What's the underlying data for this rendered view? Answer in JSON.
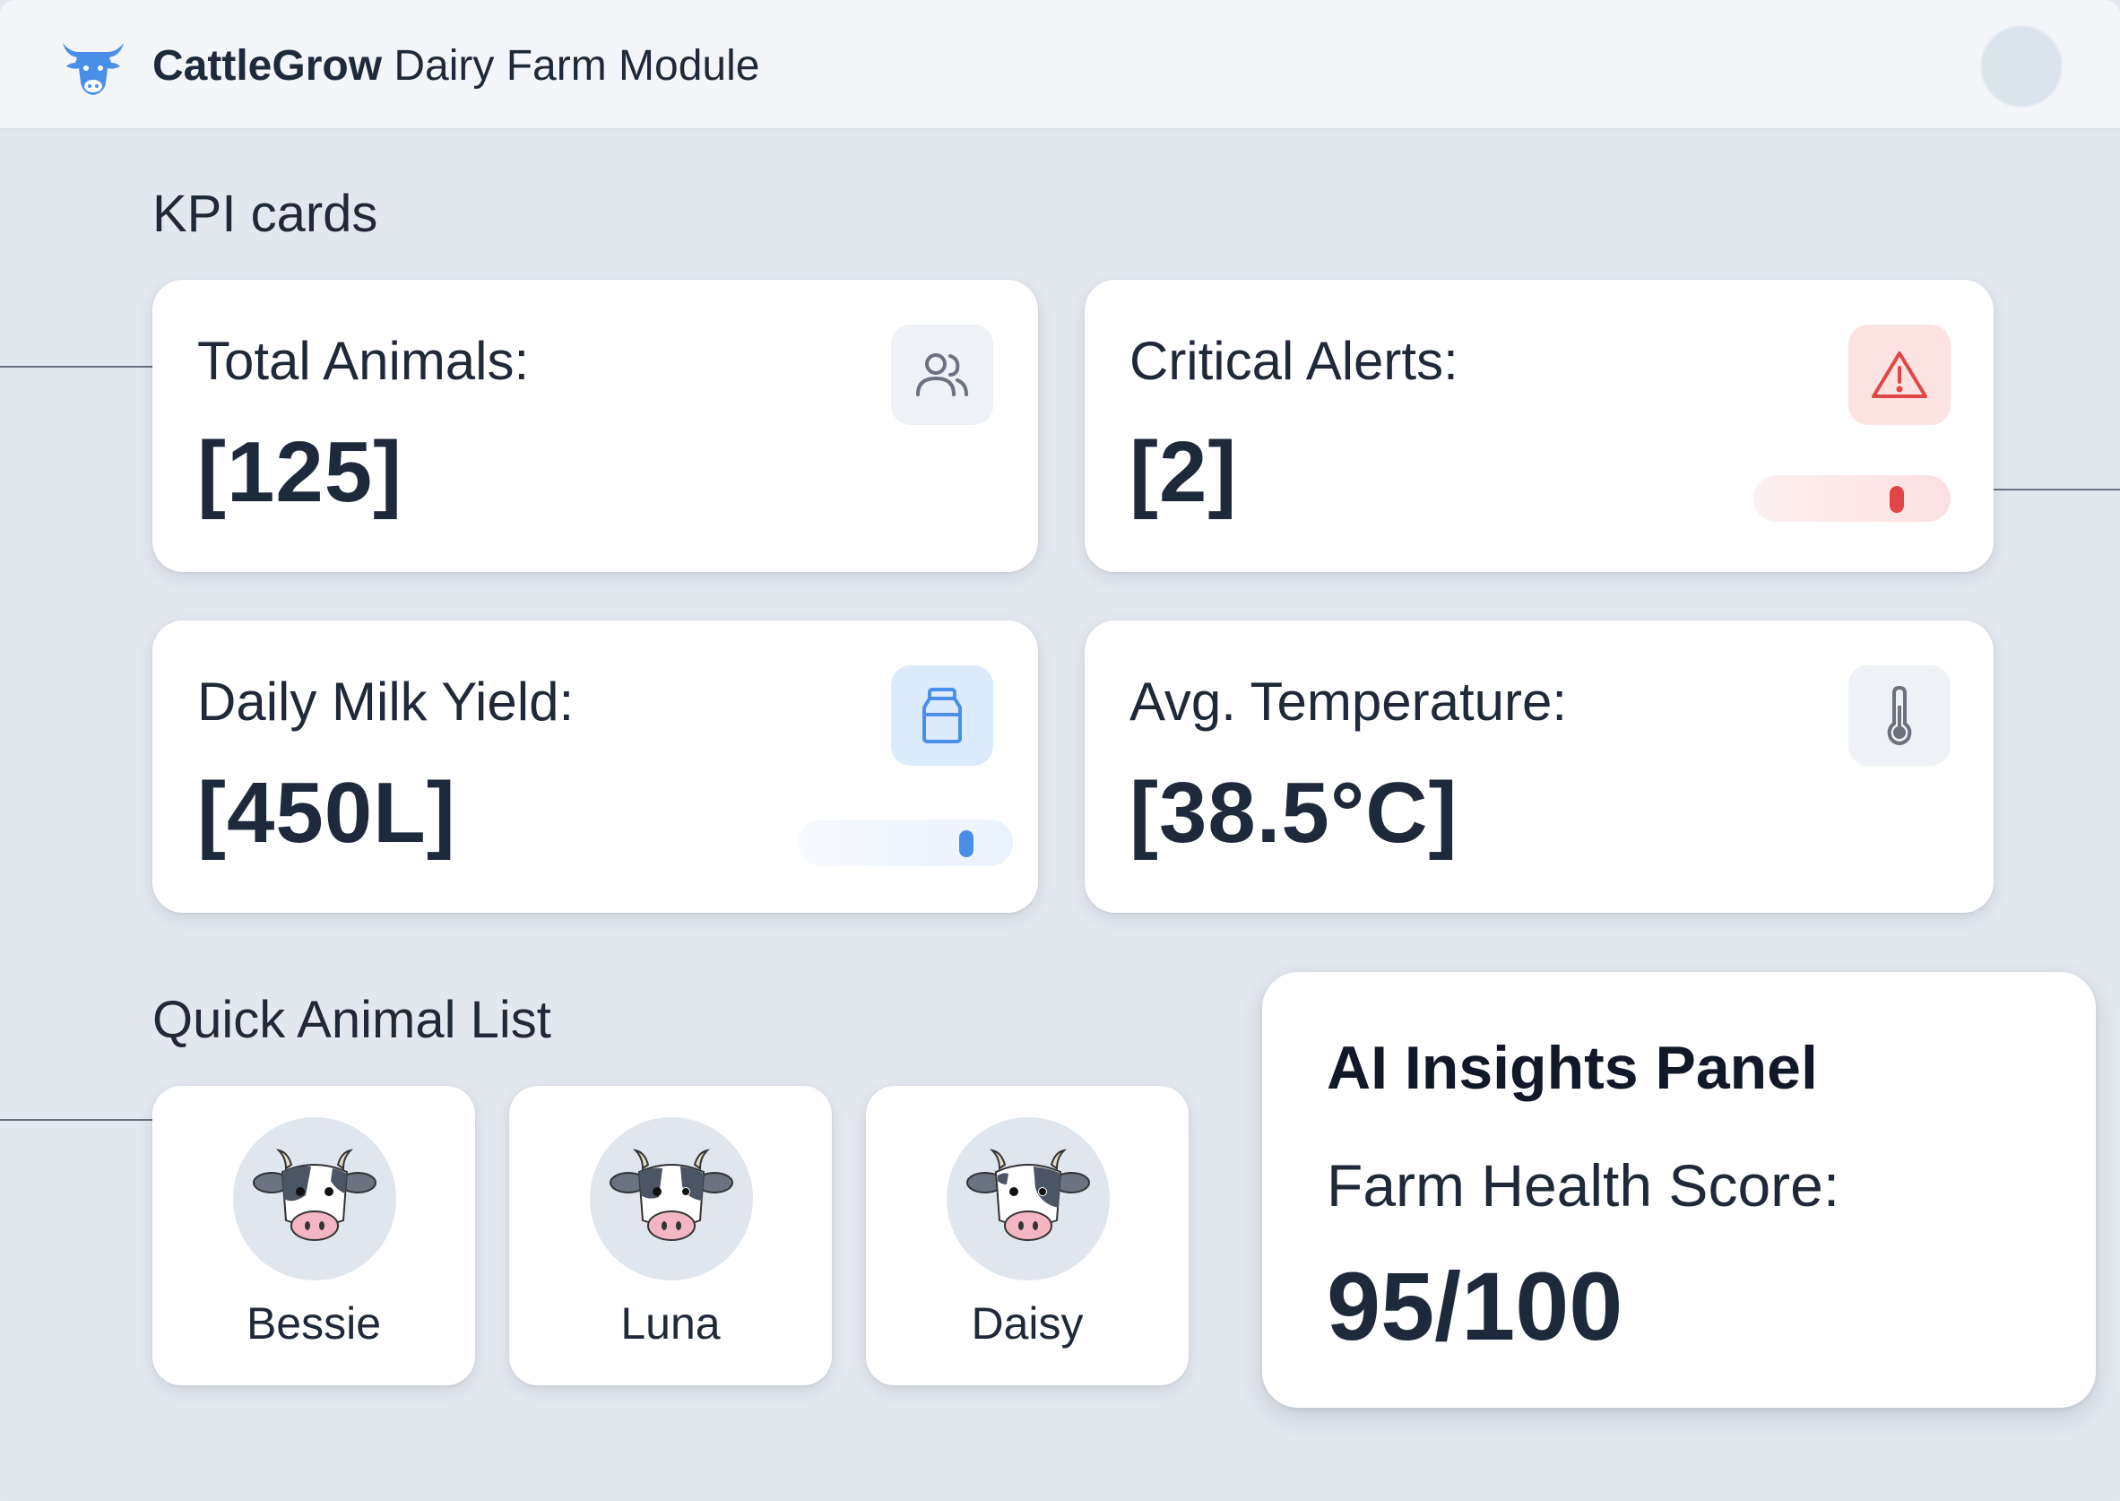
{
  "app": {
    "brand": "CattleGrow",
    "title_rest": " Dairy Farm Module"
  },
  "sections": {
    "kpi_label": "KPI cards",
    "animals_label": "Quick Animal List"
  },
  "kpis": {
    "total_animals": {
      "label": "Total Animals:",
      "value": "[125]",
      "icon": "users-icon"
    },
    "critical_alerts": {
      "label": "Critical Alerts:",
      "value": "[2]",
      "icon": "warning-icon"
    },
    "milk_yield": {
      "label": "Daily Milk Yield:",
      "value": "[450L]",
      "icon": "milk-bottle-icon"
    },
    "avg_temperature": {
      "label": "Avg. Temperature:",
      "value": "[38.5°C]",
      "icon": "thermometer-icon"
    }
  },
  "animals": [
    {
      "name": "Bessie",
      "icon": "cow-icon"
    },
    {
      "name": "Luna",
      "icon": "cow-icon"
    },
    {
      "name": "Daisy",
      "icon": "cow-icon"
    }
  ],
  "ai_panel": {
    "title": "AI Insights Panel",
    "score_label": "Farm Health Score:",
    "score_value": "95/100"
  },
  "colors": {
    "accent_blue": "#4a8fe7",
    "alert_red": "#e04646",
    "alert_bg": "#fde8e8",
    "icon_bg": "#eef1f5"
  }
}
